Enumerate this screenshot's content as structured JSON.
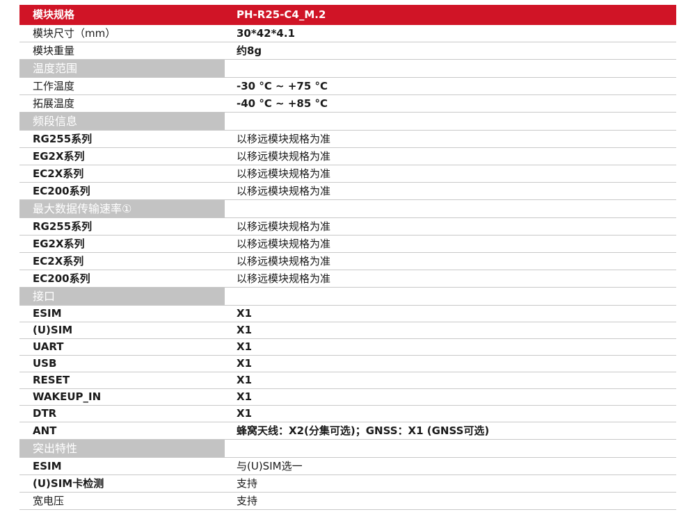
{
  "header": {
    "label": "模块规格",
    "value": "PH-R25-C4_M.2"
  },
  "rows": [
    {
      "type": "data",
      "label": "模块尺寸（mm）",
      "value": "30*42*4.1",
      "lb": false,
      "vb": true,
      "h": 25
    },
    {
      "type": "data",
      "label": "模块重量",
      "value": "约8g",
      "lb": false,
      "vb": true,
      "h": 25
    },
    {
      "type": "section",
      "label": "温度范围",
      "h": 26
    },
    {
      "type": "data",
      "label": "工作温度",
      "value": "-30 °C ~ +75 °C",
      "lb": false,
      "vb": true,
      "h": 25
    },
    {
      "type": "data",
      "label": "拓展温度",
      "value": "-40 °C ~ +85 °C",
      "lb": false,
      "vb": true,
      "h": 25
    },
    {
      "type": "section",
      "label": "频段信息",
      "h": 26
    },
    {
      "type": "data",
      "label": "RG255系列",
      "value": "以移远模块规格为准",
      "lb": true,
      "vb": false,
      "h": 25
    },
    {
      "type": "data",
      "label": "EG2X系列",
      "value": "以移远模块规格为准",
      "lb": true,
      "vb": false,
      "h": 25
    },
    {
      "type": "data",
      "label": "EC2X系列",
      "value": "以移远模块规格为准",
      "lb": true,
      "vb": false,
      "h": 25
    },
    {
      "type": "data",
      "label": "EC200系列",
      "value": "以移远模块规格为准",
      "lb": true,
      "vb": false,
      "h": 25
    },
    {
      "type": "section",
      "label": "最大数据传输速率①",
      "h": 26
    },
    {
      "type": "data",
      "label": "RG255系列",
      "value": "以移远模块规格为准",
      "lb": true,
      "vb": false,
      "h": 25
    },
    {
      "type": "data",
      "label": "EG2X系列",
      "value": "以移远模块规格为准",
      "lb": true,
      "vb": false,
      "h": 25
    },
    {
      "type": "data",
      "label": "EC2X系列",
      "value": "以移远模块规格为准",
      "lb": true,
      "vb": false,
      "h": 25
    },
    {
      "type": "data",
      "label": "EC200系列",
      "value": "以移远模块规格为准",
      "lb": true,
      "vb": false,
      "h": 25
    },
    {
      "type": "section",
      "label": "接口",
      "h": 26
    },
    {
      "type": "data",
      "label": "ESIM",
      "value": "X1",
      "lb": true,
      "vb": true,
      "h": 24
    },
    {
      "type": "data",
      "label": "(U)SIM",
      "value": "X1",
      "lb": true,
      "vb": true,
      "h": 24
    },
    {
      "type": "data",
      "label": "UART",
      "value": "X1",
      "lb": true,
      "vb": true,
      "h": 24
    },
    {
      "type": "data",
      "label": "USB",
      "value": "X1",
      "lb": true,
      "vb": true,
      "h": 24
    },
    {
      "type": "data",
      "label": "RESET",
      "value": "X1",
      "lb": true,
      "vb": true,
      "h": 24
    },
    {
      "type": "data",
      "label": "WAKEUP_IN",
      "value": "X1",
      "lb": true,
      "vb": true,
      "h": 24
    },
    {
      "type": "data",
      "label": "DTR",
      "value": "X1",
      "lb": true,
      "vb": true,
      "h": 24
    },
    {
      "type": "data",
      "label": "ANT",
      "value": "蜂窝天线：X2(分集可选)；GNSS：X1 (GNSS可选)",
      "lb": true,
      "vb": true,
      "h": 25
    },
    {
      "type": "section",
      "label": "突出特性",
      "h": 26
    },
    {
      "type": "data",
      "label": "ESIM",
      "value": "与(U)SIM选一",
      "lb": true,
      "vb": false,
      "h": 25
    },
    {
      "type": "data",
      "label": "(U)SIM卡检测",
      "value": "支持",
      "lb": true,
      "vb": false,
      "h": 25
    },
    {
      "type": "data",
      "label": "宽电压",
      "value": "支持",
      "lb": false,
      "vb": false,
      "h": 25
    }
  ]
}
